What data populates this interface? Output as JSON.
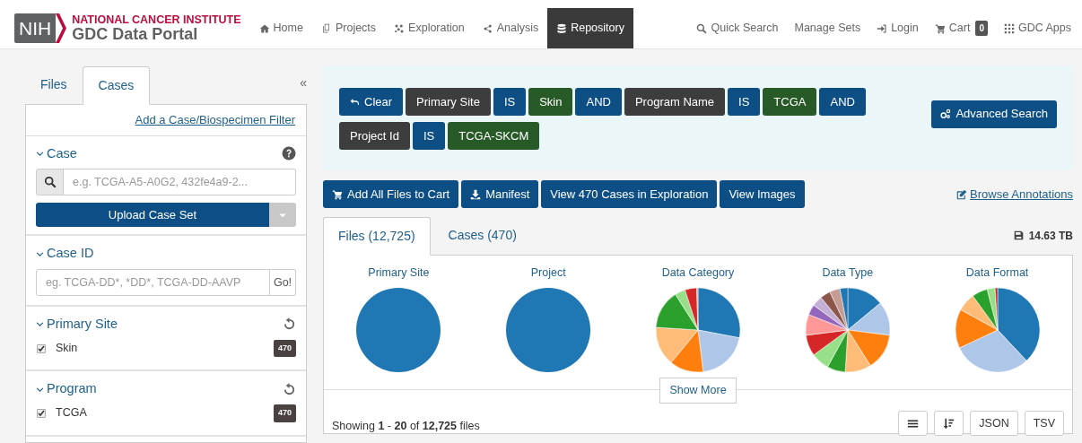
{
  "brand": {
    "mark": "NIH",
    "org": "NATIONAL CANCER INSTITUTE",
    "name": "GDC Data Portal"
  },
  "nav": [
    {
      "label": "Home",
      "selected": false
    },
    {
      "label": "Projects",
      "selected": false
    },
    {
      "label": "Exploration",
      "selected": false
    },
    {
      "label": "Analysis",
      "selected": false
    },
    {
      "label": "Repository",
      "selected": true
    }
  ],
  "nav_right": [
    {
      "label": "Quick Search"
    },
    {
      "label": "Manage Sets"
    },
    {
      "label": "Login"
    },
    {
      "label": "Cart",
      "badge": "0"
    },
    {
      "label": "GDC Apps"
    }
  ],
  "sidebar": {
    "tabs": [
      {
        "label": "Files",
        "selected": false
      },
      {
        "label": "Cases",
        "selected": true
      }
    ],
    "collapse": "«",
    "add_filter": "Add a Case/Biospecimen Filter",
    "facets": [
      {
        "kind": "search",
        "title": "Case",
        "placeholder": "e.g. TCGA-A5-A0G2, 432fe4a9-2...",
        "button": "Upload Case Set"
      },
      {
        "kind": "text",
        "title": "Case ID",
        "placeholder": "eg. TCGA-DD*, *DD*, TCGA-DD-AAVP",
        "button": "Go!"
      },
      {
        "kind": "checkbox",
        "title": "Primary Site",
        "items": [
          {
            "label": "Skin",
            "count": "470",
            "checked": true
          }
        ]
      },
      {
        "kind": "checkbox",
        "title": "Program",
        "items": [
          {
            "label": "TCGA",
            "count": "470",
            "checked": true
          }
        ]
      }
    ]
  },
  "query": {
    "pills": [
      {
        "kind": "clear",
        "text": "Clear"
      },
      {
        "kind": "field",
        "text": "Primary Site"
      },
      {
        "kind": "op",
        "text": "IS"
      },
      {
        "kind": "value",
        "text": "Skin"
      },
      {
        "kind": "op",
        "text": "AND"
      },
      {
        "kind": "field",
        "text": "Program Name"
      },
      {
        "kind": "op",
        "text": "IS"
      },
      {
        "kind": "value",
        "text": "TCGA"
      },
      {
        "kind": "op",
        "text": "AND"
      },
      {
        "kind": "field",
        "text": "Project Id"
      },
      {
        "kind": "op",
        "text": "IS"
      },
      {
        "kind": "value",
        "text": "TCGA-SKCM"
      }
    ],
    "advanced": "Advanced Search"
  },
  "actions": [
    {
      "label": "Add All Files to Cart"
    },
    {
      "label": "Manifest"
    },
    {
      "label": "View 470 Cases in Exploration"
    },
    {
      "label": "View Images"
    }
  ],
  "browse_annotations": "Browse Annotations",
  "results": {
    "tabs": [
      {
        "label": "Files (12,725)",
        "selected": true
      },
      {
        "label": "Cases (470)",
        "selected": false
      }
    ],
    "size": "14.63 TB",
    "charts": [
      {
        "title": "Primary Site"
      },
      {
        "title": "Project"
      },
      {
        "title": "Data Category"
      },
      {
        "title": "Data Type"
      },
      {
        "title": "Data Format"
      }
    ],
    "show_more": "Show More",
    "showing": "Showing **1** - **20** of **12,725** files",
    "buttons": [
      {
        "kind": "icon"
      },
      {
        "kind": "icon"
      },
      {
        "kind": "text",
        "label": "JSON"
      },
      {
        "kind": "text",
        "label": "TSV"
      }
    ]
  }
}
